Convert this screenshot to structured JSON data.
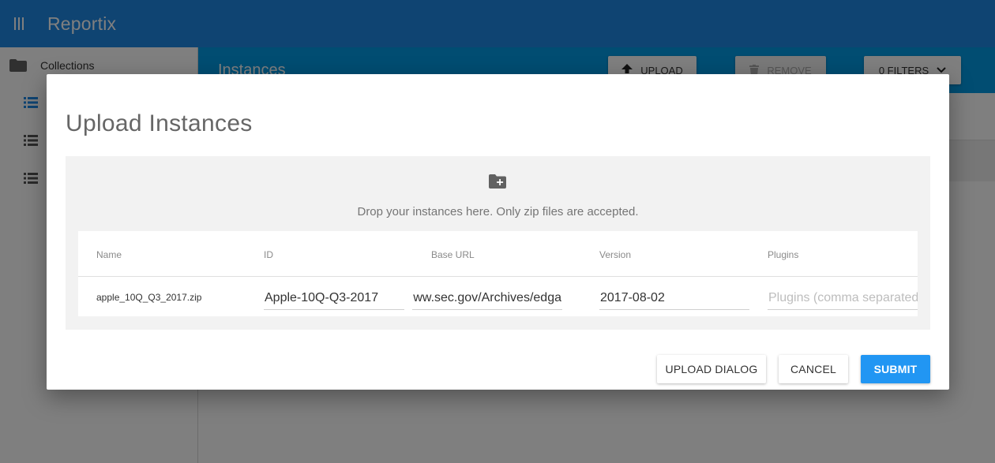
{
  "app": {
    "title": "Reportix"
  },
  "sidebar": {
    "collections_label": "Collections",
    "items": [
      {
        "icon": "list-icon",
        "active": true
      },
      {
        "icon": "list-icon",
        "active": false
      },
      {
        "icon": "list-icon",
        "active": false
      }
    ]
  },
  "content": {
    "title": "Instances",
    "upload_label": "UPLOAD",
    "remove_label": "REMOVE",
    "filters_label": "0 FILTERS"
  },
  "dialog": {
    "title": "Upload Instances",
    "drop_text": "Drop your instances here. Only zip files are accepted.",
    "columns": [
      "Name",
      "ID",
      "Base URL",
      "Version",
      "Plugins"
    ],
    "rows": [
      {
        "name": "apple_10Q_Q3_2017.zip",
        "id": "Apple-10Q-Q3-2017",
        "base_url": "https://www.sec.gov/Archives/edga",
        "version": "2017-08-02",
        "plugins": "",
        "plugins_placeholder": "Plugins (comma separated)"
      }
    ],
    "buttons": {
      "upload_dialog": "UPLOAD DIALOG",
      "cancel": "CANCEL",
      "submit": "SUBMIT"
    }
  },
  "colors": {
    "appbar": "#1e88e5",
    "content_header": "#039be5",
    "submit": "#2196f3"
  }
}
